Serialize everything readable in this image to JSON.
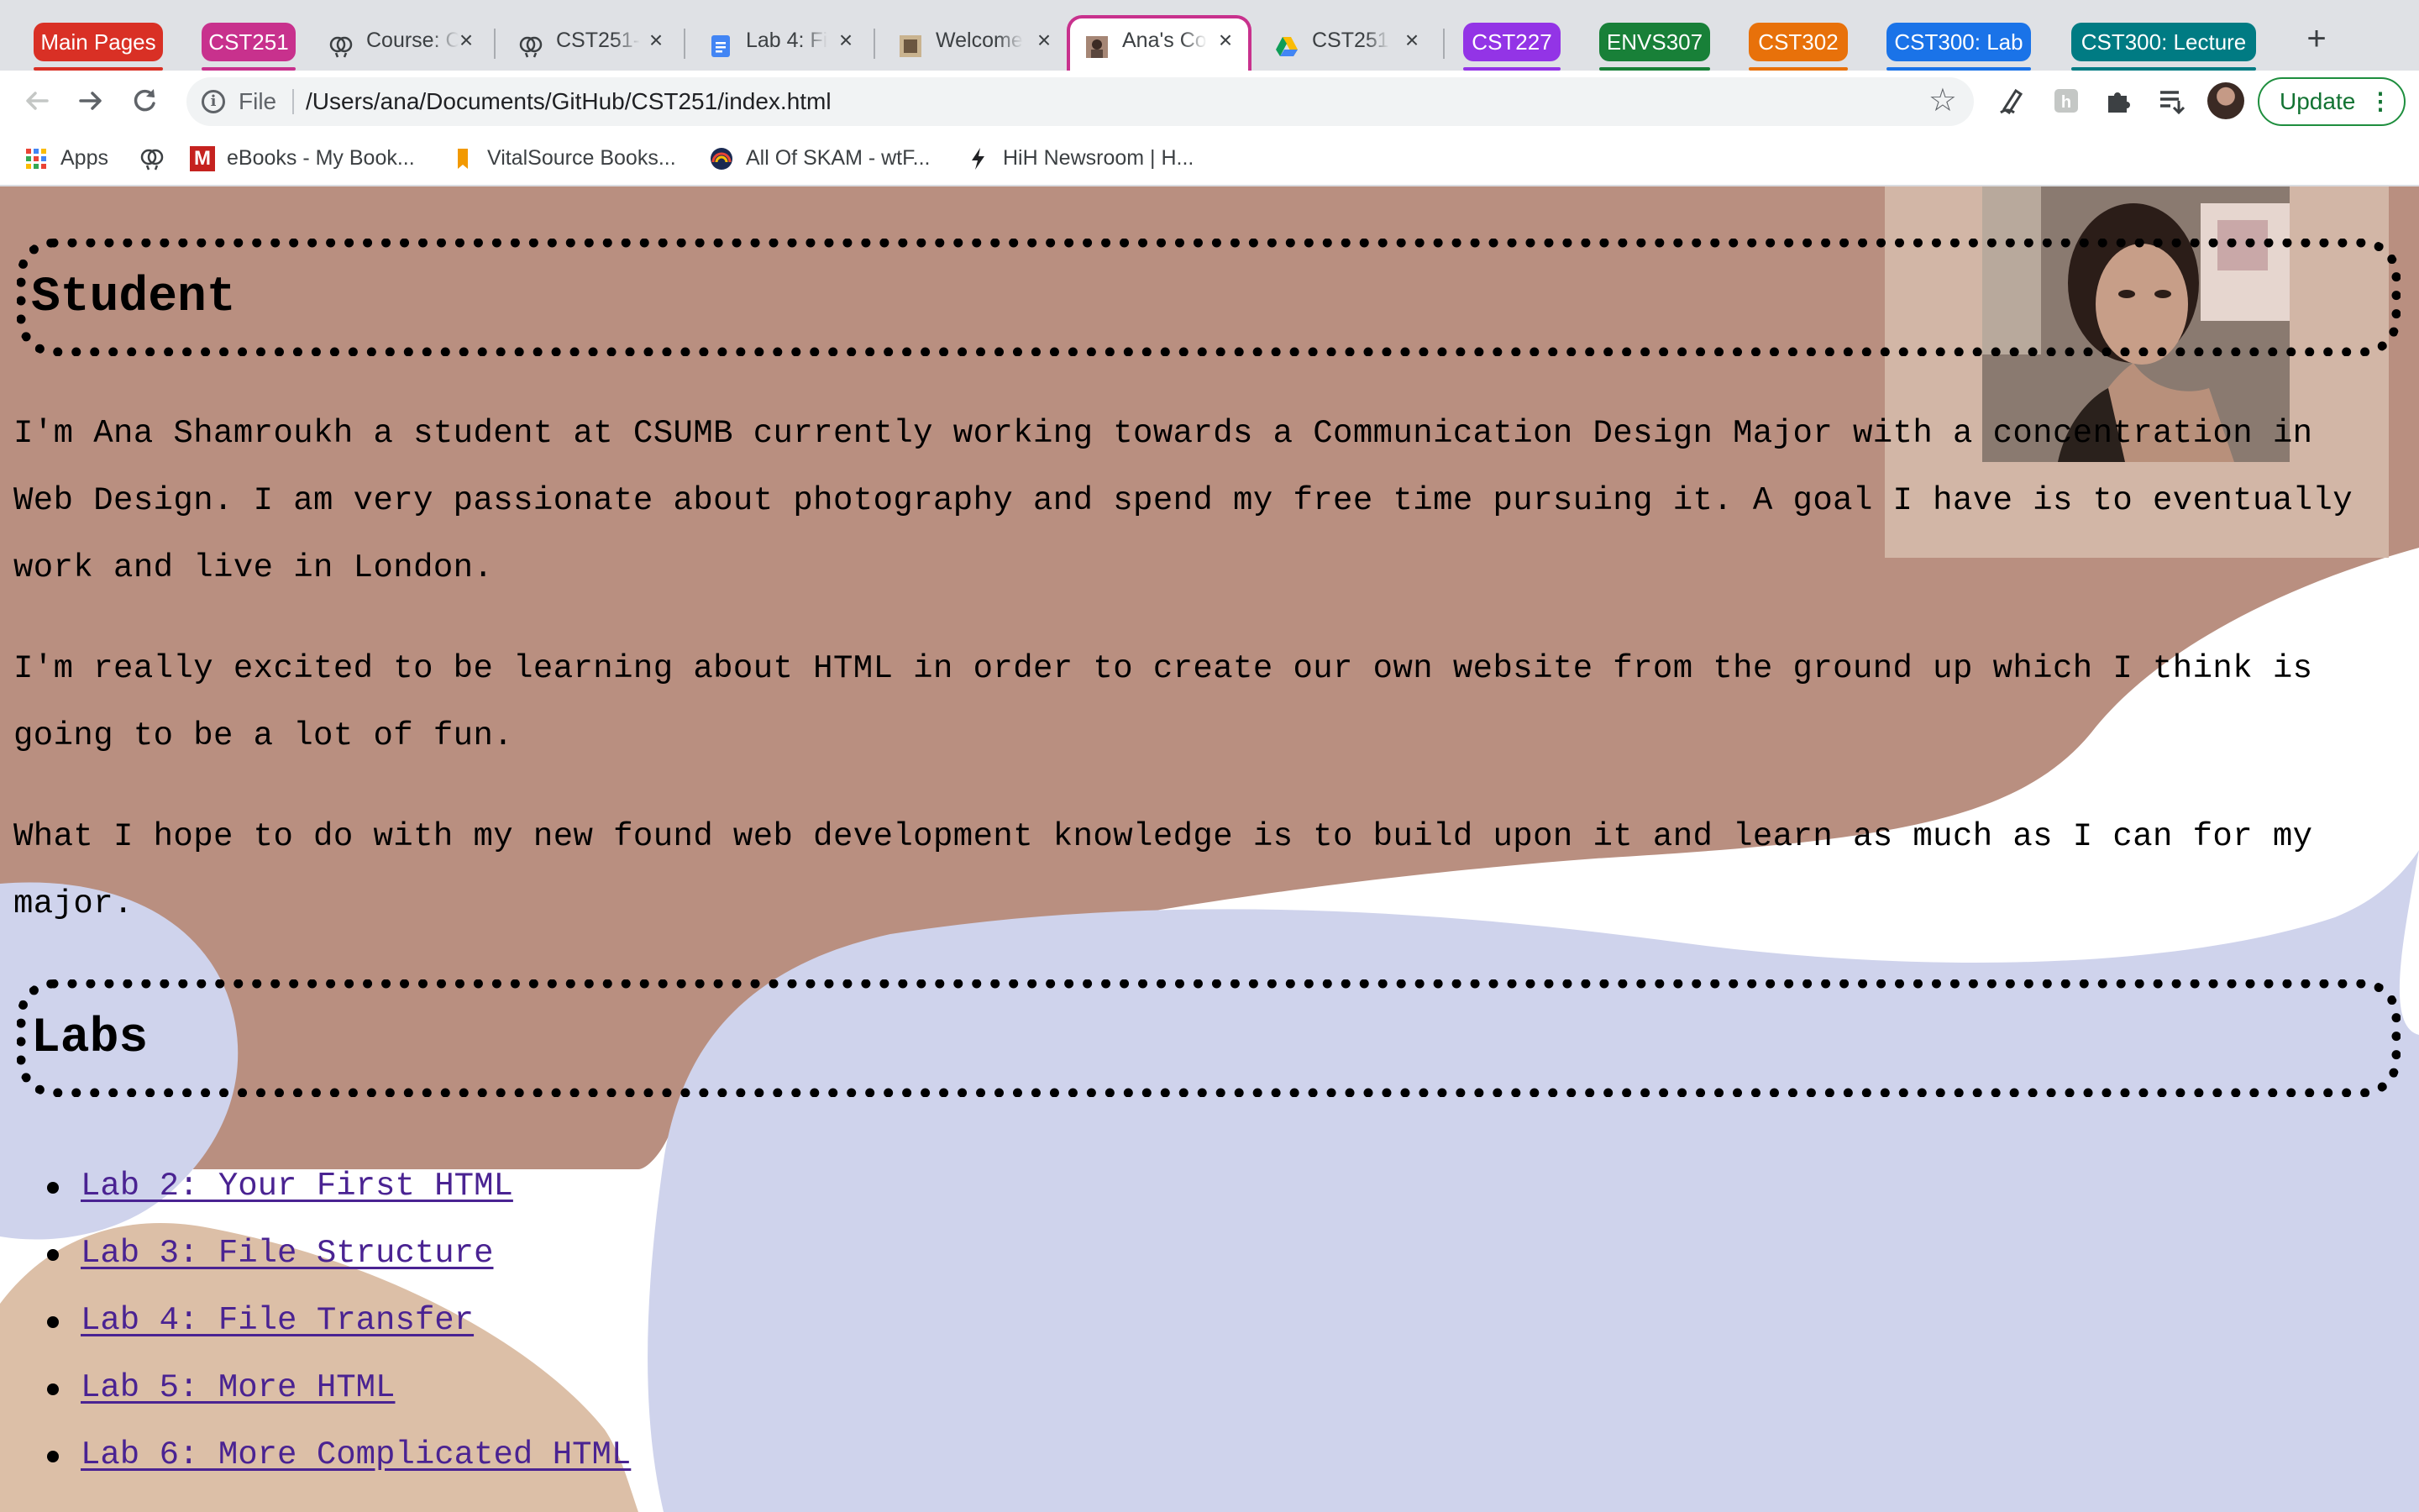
{
  "tabs": {
    "groups": [
      {
        "label": "Main Pages",
        "color": "#d93025"
      },
      {
        "label": "CST251",
        "color": "#c8318d"
      },
      {
        "label": "CST227",
        "color": "#9334e6"
      },
      {
        "label": "ENVS307",
        "color": "#188038"
      },
      {
        "label": "CST302",
        "color": "#e8710a"
      },
      {
        "label": "CST300: Lab",
        "color": "#1a73e8"
      },
      {
        "label": "CST300: Lecture",
        "color": "#007b83"
      }
    ],
    "items": [
      {
        "title": "Course: C",
        "icon": "brain-icon"
      },
      {
        "title": "CST251-",
        "icon": "brain-icon"
      },
      {
        "title": "Lab 4: Fi",
        "icon": "google-docs-icon"
      },
      {
        "title": "Welcome",
        "icon": "page-thumbnail-icon"
      },
      {
        "title": "Ana's Co",
        "icon": "portrait-thumbnail-icon",
        "active": true
      },
      {
        "title": "CST251",
        "icon": "google-drive-icon"
      }
    ],
    "close_glyph": "×",
    "new_tab_glyph": "+"
  },
  "toolbar": {
    "back_icon": "back-arrow-icon",
    "forward_icon": "forward-arrow-icon",
    "reload_icon": "reload-icon",
    "scheme": "File",
    "url": "/Users/ana/Documents/GitHub/CST251/index.html",
    "update_label": "Update"
  },
  "bookmarks": [
    {
      "label": "Apps",
      "icon": "apps-grid-icon"
    },
    {
      "label": "",
      "icon": "brain-icon"
    },
    {
      "label": "eBooks - My Book...",
      "icon": "m-logo-icon"
    },
    {
      "label": "VitalSource Books...",
      "icon": "vitalsource-icon"
    },
    {
      "label": "All Of SKAM - wtF...",
      "icon": "rainbow-circle-icon"
    },
    {
      "label": "HiH Newsroom | H...",
      "icon": "lightning-icon"
    }
  ],
  "page": {
    "student_heading": "Student",
    "paragraphs": [
      "I'm Ana Shamroukh a student at CSUMB currently working towards a Communication Design Major with a concentration in Web Design. I am very passionate about photography and spend my free time pursuing it. A goal I have is to eventually work and live in London.",
      "I'm really excited to be learning about HTML in order to create our own website from the ground up which I think is going to be a lot of fun.",
      "What I hope to do with my new found web development knowledge is to build upon it and learn as much as I can for my major."
    ],
    "labs_heading": "Labs",
    "labs": [
      "Lab 2: Your First HTML",
      "Lab 3: File Structure",
      "Lab 4: File Transfer",
      "Lab 5: More HTML",
      "Lab 6: More Complicated HTML"
    ],
    "colors": {
      "brown_blob": "#b98f80",
      "lavender_blob": "#cfd3ec",
      "tan_blob": "#dcbfa7",
      "link": "#4a2392"
    }
  }
}
